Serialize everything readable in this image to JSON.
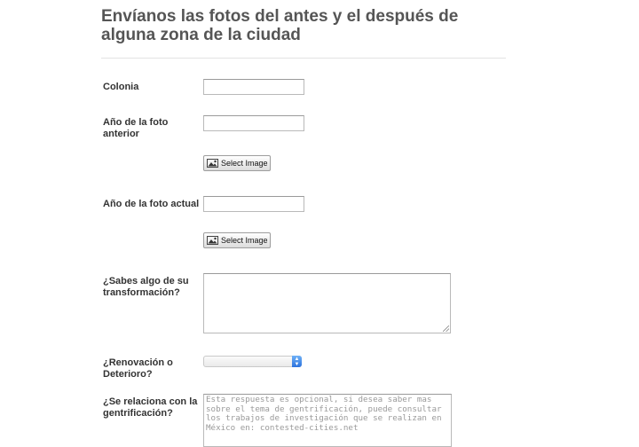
{
  "form": {
    "title": "Envíanos las fotos del antes y el después de alguna zona de la ciudad"
  },
  "fields": {
    "colonia": {
      "label": "Colonia",
      "value": ""
    },
    "anio_anterior": {
      "label": "Año de la foto anterior",
      "value": ""
    },
    "upload_anterior": {
      "label": "Select Image",
      "icon": "image-icon"
    },
    "anio_actual": {
      "label": "Año de la foto actual",
      "value": ""
    },
    "upload_actual": {
      "label": "Select Image",
      "icon": "image-icon"
    },
    "transformacion": {
      "label": "¿Sabes algo de su transformación?",
      "value": ""
    },
    "renovacion": {
      "label": "¿Renovación o Deterioro?",
      "selected": ""
    },
    "gentrificacion": {
      "label": "¿Se relaciona con la gentrificación?",
      "placeholder": "Esta respuesta es opcional, si desea saber mas sobre el tema de gentrificación, puede consultar los trabajos de investigación que se realizan en México en: contested-cities.net"
    }
  },
  "colors": {
    "select_arrow": "#2c72dd",
    "title": "#555555"
  }
}
